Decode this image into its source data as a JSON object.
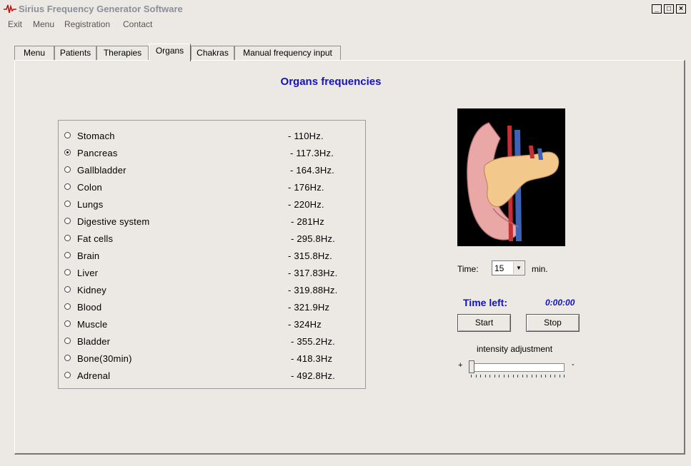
{
  "window": {
    "title": "Sirius Frequency Generator Software",
    "minimize_label": "_",
    "maximize_label": "□",
    "close_label": "×"
  },
  "menubar": [
    "Exit",
    "Menu",
    "Registration",
    "Contact"
  ],
  "tabs": [
    "Menu",
    "Patients",
    "Therapies",
    "Organs",
    "Chakras",
    "Manual frequency input"
  ],
  "active_tab": "Organs",
  "heading": "Organs frequencies",
  "organs": [
    {
      "name": "Stomach",
      "freq": "- 110Hz."
    },
    {
      "name": "Pancreas",
      "freq": "- 117.3Hz.",
      "selected": true
    },
    {
      "name": "Gallbladder",
      "freq": "- 164.3Hz."
    },
    {
      "name": "Colon",
      "freq": "- 176Hz."
    },
    {
      "name": "Lungs",
      "freq": "- 220Hz."
    },
    {
      "name": "Digestive system",
      "freq": "- 281Hz"
    },
    {
      "name": "Fat cells",
      "freq": "- 295.8Hz."
    },
    {
      "name": "Brain",
      "freq": "- 315.8Hz."
    },
    {
      "name": "Liver",
      "freq": "- 317.83Hz."
    },
    {
      "name": "Kidney",
      "freq": "- 319.88Hz."
    },
    {
      "name": "Blood",
      "freq": "- 321.9Hz"
    },
    {
      "name": "Muscle",
      "freq": "- 324Hz"
    },
    {
      "name": "Bladder",
      "freq": "- 355.2Hz."
    },
    {
      "name": "Bone(30min)",
      "freq": "- 418.3Hz"
    },
    {
      "name": "Adrenal",
      "freq": "- 492.8Hz."
    }
  ],
  "time": {
    "label": "Time:",
    "value": "15",
    "unit": "min."
  },
  "time_left": {
    "label": "Time left:",
    "value": "0:00:00"
  },
  "buttons": {
    "start": "Start",
    "stop": "Stop"
  },
  "intensity": {
    "label": "intensity adjustment",
    "plus": "+",
    "minus": "-",
    "level": 0
  },
  "colors": {
    "accent_blue": "#1414b4",
    "background": "#ece9e4"
  }
}
